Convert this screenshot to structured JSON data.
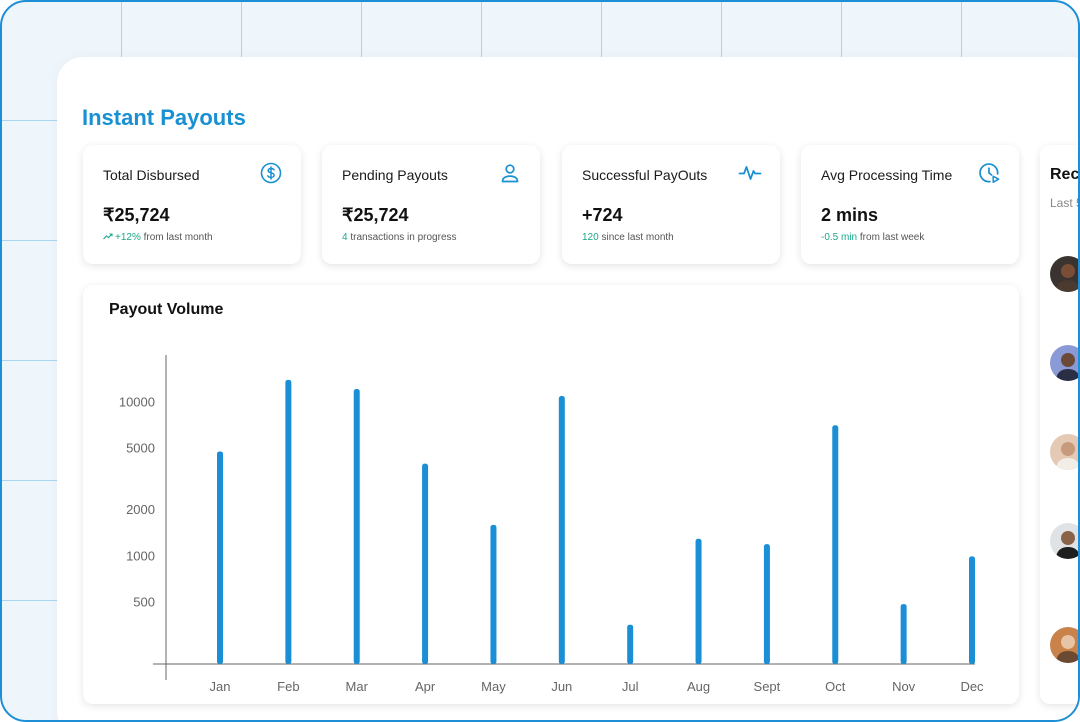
{
  "page": {
    "title": "Instant Payouts"
  },
  "cards": [
    {
      "label": "Total Disbursed",
      "icon": "dollar-circle-icon",
      "value": "₹25,724",
      "note_accent": "+12%",
      "note_text": "from last month",
      "trend_icon": "trend-up-icon"
    },
    {
      "label": "Pending Payouts",
      "icon": "user-icon",
      "value": "₹25,724",
      "note_accent": "4",
      "note_text": "transactions in progress"
    },
    {
      "label": "Successful PayOuts",
      "icon": "activity-pulse-icon",
      "value": "+724",
      "note_accent": "120",
      "note_text": "since last month"
    },
    {
      "label": "Avg Processing Time",
      "icon": "clock-icon",
      "value": "2 mins",
      "note_accent": "-0.5 min",
      "note_text": "from last week"
    }
  ],
  "recent": {
    "title": "Rece",
    "subtitle": "Last 5",
    "avatar_count": 5
  },
  "colors": {
    "accent": "#1890d2",
    "bar": "#1a8fd6",
    "positive": "#1aa88a"
  },
  "chart_data": {
    "type": "bar",
    "title": "Payout Volume",
    "xlabel": "",
    "ylabel": "",
    "categories": [
      "Jan",
      "Feb",
      "Mar",
      "Apr",
      "May",
      "Jun",
      "Jul",
      "Aug",
      "Sept",
      "Oct",
      "Nov",
      "Dec"
    ],
    "y_ticks": [
      "10000",
      "5000",
      "2000",
      "1000",
      "500"
    ],
    "tick_values": [
      10000,
      5000,
      2000,
      1000,
      500
    ],
    "values": [
      4800,
      14000,
      12200,
      4000,
      1600,
      11000,
      360,
      1300,
      1200,
      7100,
      490,
      1000
    ]
  }
}
